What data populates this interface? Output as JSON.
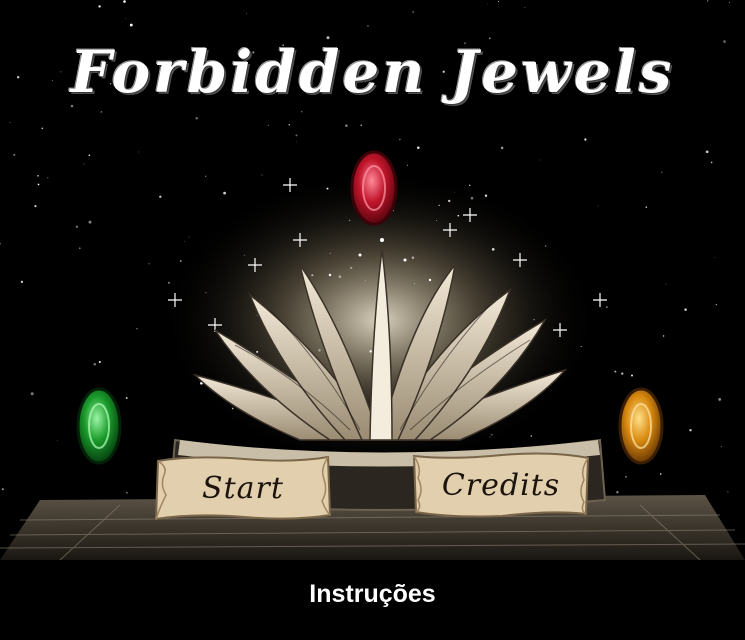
{
  "game": {
    "title": "Forbidden Jewels",
    "start_label": "Start",
    "credits_label": "Credits",
    "instructions_label": "Instruções"
  },
  "colors": {
    "background": "#000000",
    "jewel_red": "#c0142a",
    "jewel_green": "#1a9a2a",
    "jewel_orange": "#d98a10",
    "parchment": "#e2cfae"
  },
  "icons": [
    "red-jewel-icon",
    "green-jewel-icon",
    "orange-jewel-icon",
    "open-book-illustration"
  ]
}
